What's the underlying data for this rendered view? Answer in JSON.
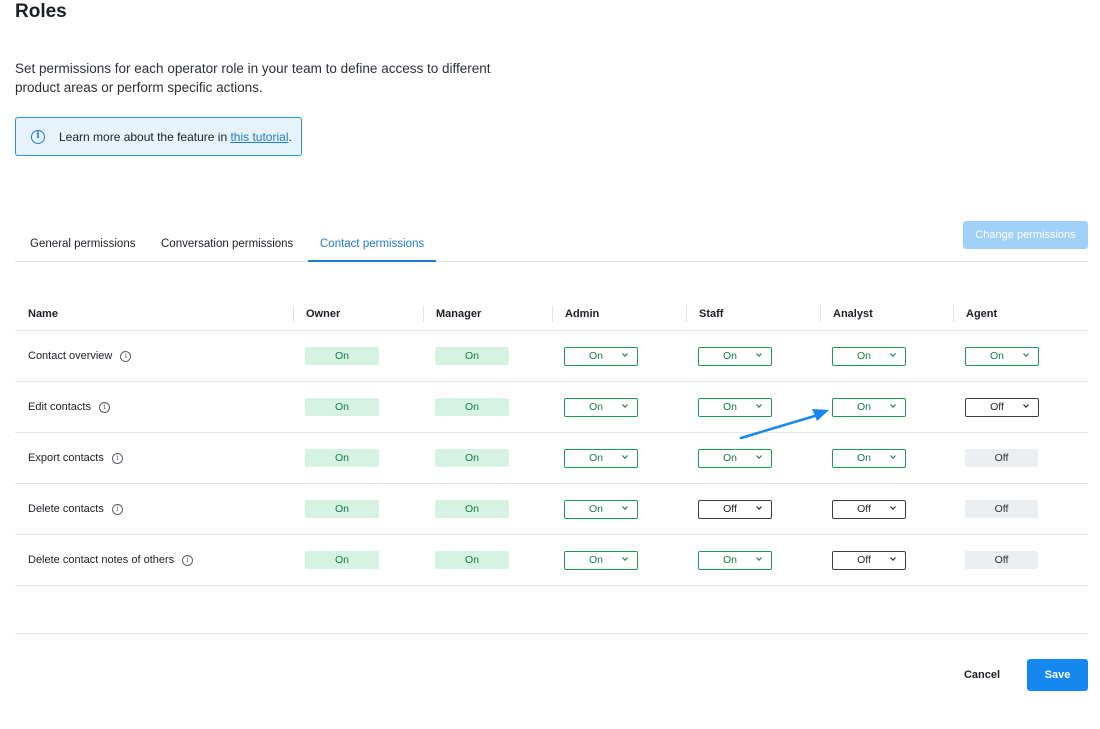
{
  "page": {
    "title": "Roles",
    "description": "Set permissions for each operator role in your team to define access to different product areas or perform specific actions.",
    "info_text": "Learn more about the feature in ",
    "info_link": "this tutorial",
    "info_suffix": ".",
    "change_permissions": "Change permissions"
  },
  "tabs": [
    {
      "label": "General permissions",
      "active": false
    },
    {
      "label": "Conversation permissions",
      "active": false
    },
    {
      "label": "Contact permissions",
      "active": true
    }
  ],
  "table": {
    "columns": [
      "Name",
      "Owner",
      "Manager",
      "Admin",
      "Staff",
      "Analyst",
      "Agent"
    ],
    "rows": [
      {
        "name": "Contact overview",
        "cells": [
          {
            "value": "On",
            "type": "badge"
          },
          {
            "value": "On",
            "type": "badge"
          },
          {
            "value": "On",
            "type": "select"
          },
          {
            "value": "On",
            "type": "select"
          },
          {
            "value": "On",
            "type": "select"
          },
          {
            "value": "On",
            "type": "select"
          }
        ]
      },
      {
        "name": "Edit contacts",
        "cells": [
          {
            "value": "On",
            "type": "badge"
          },
          {
            "value": "On",
            "type": "badge"
          },
          {
            "value": "On",
            "type": "select"
          },
          {
            "value": "On",
            "type": "select"
          },
          {
            "value": "On",
            "type": "select"
          },
          {
            "value": "Off",
            "type": "select"
          }
        ]
      },
      {
        "name": "Export contacts",
        "cells": [
          {
            "value": "On",
            "type": "badge"
          },
          {
            "value": "On",
            "type": "badge"
          },
          {
            "value": "On",
            "type": "select"
          },
          {
            "value": "On",
            "type": "select"
          },
          {
            "value": "On",
            "type": "select"
          },
          {
            "value": "Off",
            "type": "badge"
          }
        ]
      },
      {
        "name": "Delete contacts",
        "cells": [
          {
            "value": "On",
            "type": "badge"
          },
          {
            "value": "On",
            "type": "badge"
          },
          {
            "value": "On",
            "type": "select"
          },
          {
            "value": "Off",
            "type": "select"
          },
          {
            "value": "Off",
            "type": "select"
          },
          {
            "value": "Off",
            "type": "badge"
          }
        ]
      },
      {
        "name": "Delete contact notes of others",
        "cells": [
          {
            "value": "On",
            "type": "badge"
          },
          {
            "value": "On",
            "type": "badge"
          },
          {
            "value": "On",
            "type": "select"
          },
          {
            "value": "On",
            "type": "select"
          },
          {
            "value": "Off",
            "type": "select"
          },
          {
            "value": "Off",
            "type": "badge"
          }
        ]
      }
    ]
  },
  "footer": {
    "cancel": "Cancel",
    "save": "Save"
  },
  "colors": {
    "accent": "#1f7bc4",
    "save": "#1687f0",
    "on_bg": "#d5f2e2",
    "on_text": "#137a43",
    "annotation_arrow": "#1a86f0"
  },
  "icons": {
    "info": "info-icon",
    "chevron": "chevron-down-icon",
    "annotation": "arrow-annotation-icon"
  }
}
